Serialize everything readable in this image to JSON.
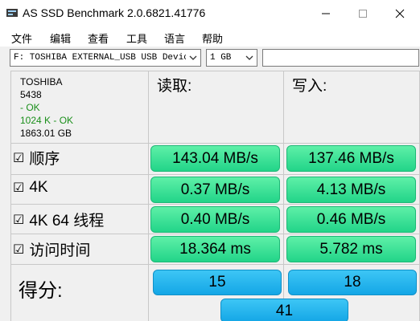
{
  "window": {
    "title": "AS SSD Benchmark 2.0.6821.41776"
  },
  "menu": {
    "items": [
      "文件",
      "编辑",
      "查看",
      "工具",
      "语言",
      "帮助"
    ]
  },
  "toolbar": {
    "drive": "F: TOSHIBA EXTERNAL_USB USB Devic",
    "size": "1 GB",
    "text_value": ""
  },
  "drive_info": {
    "model": "TOSHIBA",
    "firmware": "5438",
    "driver_status": "- OK",
    "alignment": "1024 K - OK",
    "capacity": "1863.01 GB"
  },
  "columns": {
    "read": "读取:",
    "write": "写入:"
  },
  "rows": [
    {
      "checkbox": "☑",
      "label": "顺序",
      "read": "143.04 MB/s",
      "write": "137.46 MB/s"
    },
    {
      "checkbox": "☑",
      "label": "4K",
      "read": "0.37 MB/s",
      "write": "4.13 MB/s"
    },
    {
      "checkbox": "☑",
      "label": "4K 64 线程",
      "read": "0.40 MB/s",
      "write": "0.46 MB/s"
    },
    {
      "checkbox": "☑",
      "label": "访问时间",
      "read": "18.364 ms",
      "write": "5.782 ms"
    }
  ],
  "score": {
    "label": "得分:",
    "read": "15",
    "write": "18",
    "total": "41"
  },
  "colors": {
    "result_green": "#22d489",
    "score_blue": "#14a6e6",
    "ok_green": "#1a8f1a"
  }
}
